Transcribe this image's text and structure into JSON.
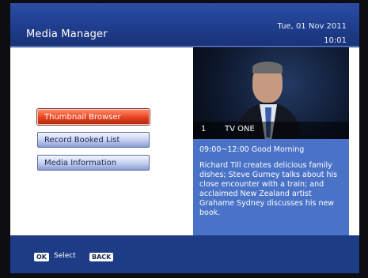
{
  "header": {
    "title": "Media Manager",
    "date": "Tue, 01 Nov 2011",
    "time": "10:01"
  },
  "menu": {
    "items": [
      {
        "label": "Thumbnail Browser",
        "selected": true
      },
      {
        "label": "Record Booked List",
        "selected": false
      },
      {
        "label": "Media Information",
        "selected": false
      }
    ]
  },
  "preview": {
    "channel_number": "1",
    "channel_name": "TV ONE"
  },
  "program": {
    "title": "09:00~12:00  Good Morning",
    "description": "Richard Till creates delicious family dishes; Steve Gurney talks about his close encounter with a train; and acclaimed New Zealand artist Grahame Sydney discusses his new book."
  },
  "footer": {
    "ok_key": "OK",
    "select_label": "Select",
    "back_key": "BACK"
  },
  "colors": {
    "header_blue": "#1e3c86",
    "info_blue": "#4a73c7",
    "selected_red": "#e8411f"
  }
}
